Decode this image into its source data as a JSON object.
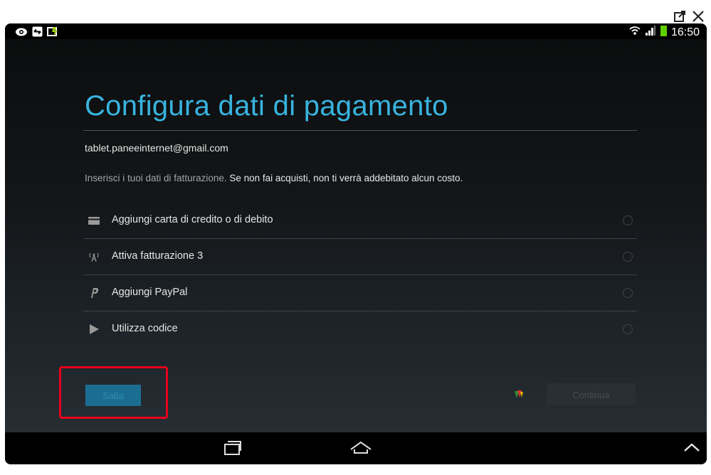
{
  "window": {
    "popout_icon": "popout-icon",
    "close_icon": "close-icon"
  },
  "status_bar": {
    "time": "16:50",
    "left_icons": [
      "eye-icon",
      "sync-box-icon",
      "battery-charge-icon"
    ],
    "right_icons": [
      "wifi-icon",
      "signal-icon",
      "battery-icon"
    ]
  },
  "page": {
    "title": "Configura dati di pagamento",
    "email": "tablet.paneeinternet@gmail.com",
    "description_prefix": "Inserisci i tuoi dati di fatturazione.",
    "description_highlight": " Se non fai acquisti, non ti verrà addebitato alcun costo.",
    "options": [
      {
        "icon": "credit-card-icon",
        "label": "Aggiungi carta di credito o di debito"
      },
      {
        "icon": "carrier-billing-icon",
        "label": "Attiva fatturazione 3"
      },
      {
        "icon": "paypal-icon",
        "label": "Aggiungi PayPal"
      },
      {
        "icon": "play-store-icon",
        "label": "Utilizza codice"
      }
    ]
  },
  "buttons": {
    "skip_label": "Salta",
    "continue_label": "Continua"
  },
  "colors": {
    "title": "#38b3de",
    "highlight_box": "#e8001b",
    "skip_button": "#1b6e91"
  },
  "nav_bar": {
    "icons": [
      "recent-apps-icon",
      "home-icon",
      "expand-up-icon"
    ]
  }
}
